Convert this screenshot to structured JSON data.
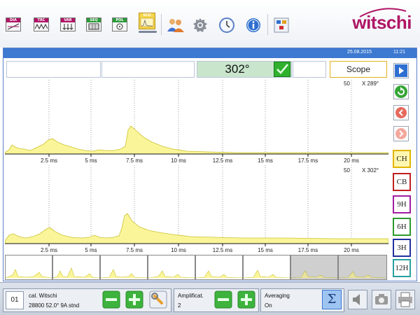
{
  "toolbar": {
    "modes": [
      {
        "label": "DIA",
        "icon": "dia-icon"
      },
      {
        "label": "TRC",
        "icon": "trc-icon"
      },
      {
        "label": "VAR",
        "icon": "var-icon"
      },
      {
        "label": "SEQ",
        "icon": "seq-icon"
      },
      {
        "label": "POL",
        "icon": "pol-icon"
      },
      {
        "label": "SCO",
        "icon": "sco-icon"
      }
    ],
    "active_mode": "SCO",
    "tools": [
      "users-icon",
      "gear-icon",
      "clock-icon",
      "info-icon",
      "network-icon"
    ],
    "logo_text": "witschi"
  },
  "status": {
    "date": "25.08.2015",
    "time": "11:21"
  },
  "display": {
    "field1": "",
    "field2": "",
    "angle": "302°",
    "field4": "",
    "mode_label": "Scope"
  },
  "plots": [
    {
      "peak_count": "50",
      "peak_angle": "X  289°",
      "ticks": [
        "2.5 ms",
        "5 ms",
        "7.5 ms",
        "10 ms",
        "12.5 ms",
        "15 ms",
        "17.5 ms",
        "20 ms"
      ]
    },
    {
      "peak_count": "50",
      "peak_angle": "X  302°",
      "ticks": [
        "2.5 ms",
        "5 ms",
        "7.5 ms",
        "10 ms",
        "12.5 ms",
        "15 ms",
        "17.5 ms",
        "20 ms"
      ]
    }
  ],
  "sidebar": {
    "nav": [
      "play-icon",
      "refresh-icon",
      "back-icon",
      "forward-icon"
    ],
    "harmonics": [
      {
        "label": "CH",
        "color": "#e3b400",
        "bg": "#fff7b0"
      },
      {
        "label": "CB",
        "color": "#c02020",
        "bg": "#ffffff"
      },
      {
        "label": "9H",
        "color": "#a01ea0",
        "bg": "#ffffff"
      },
      {
        "label": "6H",
        "color": "#2e9a2e",
        "bg": "#ffffff"
      },
      {
        "label": "3H",
        "color": "#2030a0",
        "bg": "#ffffff"
      },
      {
        "label": "12H",
        "color": "#2aa0a0",
        "bg": "#ffffff"
      }
    ]
  },
  "bottombar": {
    "slot": "01",
    "calibration": {
      "line1": "cal. Witschi",
      "line2": "28800  52.0°  9A   stnd"
    },
    "amplification": {
      "label": "Amplificat.",
      "value": "2"
    },
    "averaging": {
      "label": "Averaging",
      "value": "On"
    },
    "sigma_label": "Σ"
  },
  "colors": {
    "accent": "#3d79d1",
    "brand": "#b01566",
    "trace_fill": "#fbf59a",
    "trace_line": "#c9c230"
  }
}
